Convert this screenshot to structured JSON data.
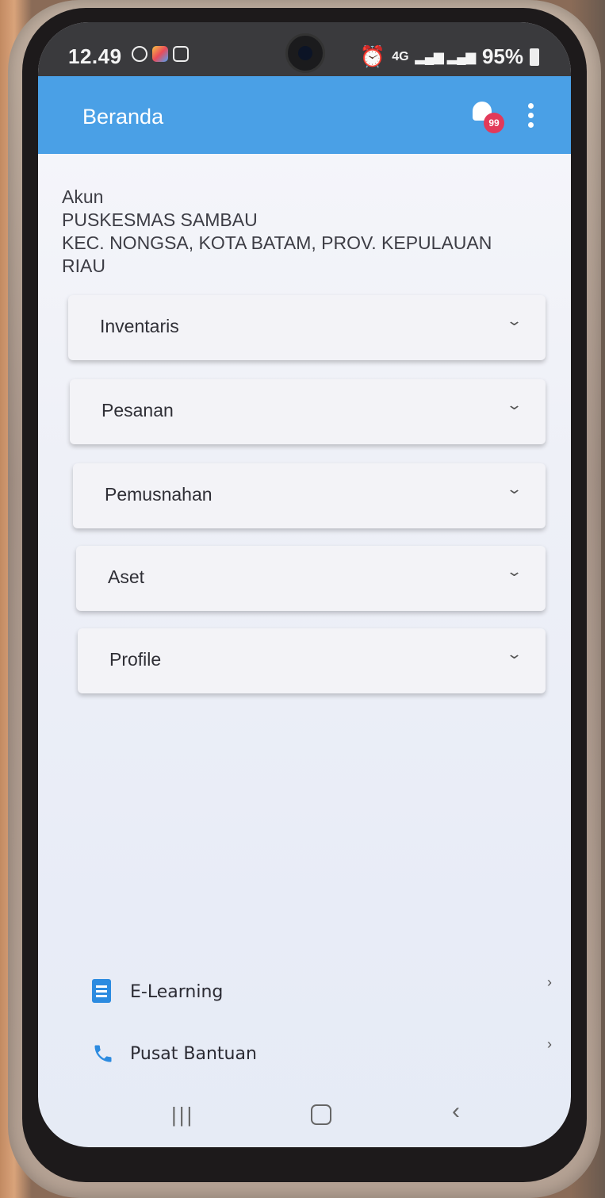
{
  "status_bar": {
    "time": "12.49",
    "network": "4G",
    "battery": "95%"
  },
  "app_bar": {
    "title": "Beranda",
    "notification_count": "99"
  },
  "account": {
    "label": "Akun",
    "name": "PUSKESMAS SAMBAU",
    "address": "KEC. NONGSA, KOTA BATAM, PROV. KEPULAUAN RIAU"
  },
  "menu": [
    {
      "label": "Inventaris"
    },
    {
      "label": "Pesanan"
    },
    {
      "label": "Pemusnahan"
    },
    {
      "label": "Aset"
    },
    {
      "label": "Profile"
    }
  ],
  "links": [
    {
      "label": "E-Learning",
      "icon": "document-icon"
    },
    {
      "label": "Pusat Bantuan",
      "icon": "phone-icon"
    }
  ],
  "colors": {
    "app_bar": "#4aa0e6",
    "badge": "#e23a5a",
    "link_icon": "#2c8be0"
  }
}
